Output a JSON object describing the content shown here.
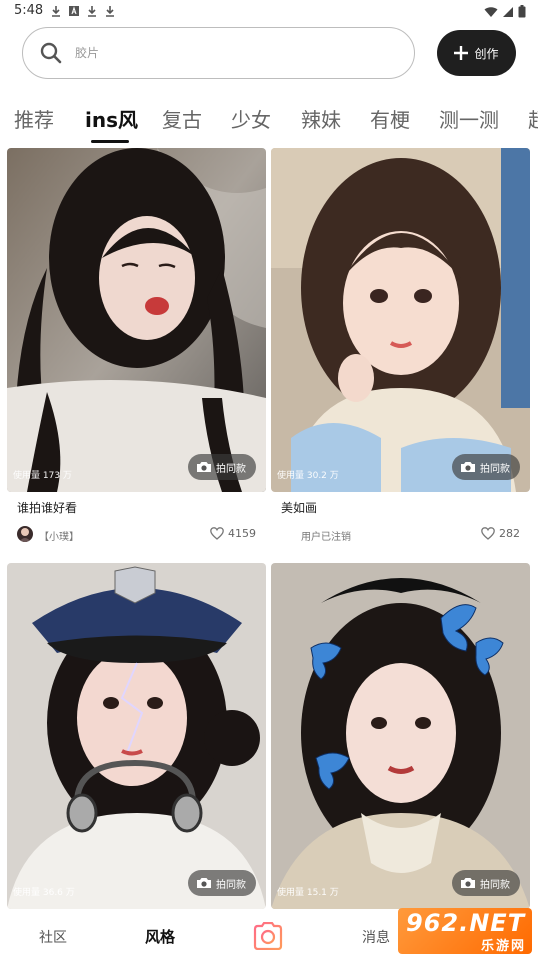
{
  "status_bar": {
    "time": "5:48"
  },
  "search": {
    "placeholder": "胶片"
  },
  "create_button": {
    "label": "创作"
  },
  "tabs": [
    {
      "label": "推荐",
      "active": false
    },
    {
      "label": "ins风",
      "active": true
    },
    {
      "label": "复古",
      "active": false
    },
    {
      "label": "少女",
      "active": false
    },
    {
      "label": "辣妹",
      "active": false
    },
    {
      "label": "有梗",
      "active": false
    },
    {
      "label": "测一测",
      "active": false
    },
    {
      "label": "超",
      "active": false
    }
  ],
  "cards": [
    {
      "usage": "使用量 173 万",
      "action": "拍同款",
      "title": "谁拍谁好看",
      "author": "【小璞】",
      "likes": "4159"
    },
    {
      "usage": "使用量 30.2 万",
      "action": "拍同款",
      "title": "美如画",
      "author": "用户已注销",
      "likes": "282"
    },
    {
      "usage": "使用量 36.6 万",
      "action": "拍同款",
      "title": "",
      "author": "",
      "likes": ""
    },
    {
      "usage": "使用量 15.1 万",
      "action": "拍同款",
      "title": "",
      "author": "",
      "likes": ""
    }
  ],
  "bottom_nav": {
    "community": "社区",
    "style": "风格",
    "messages": "消息",
    "active": "风格"
  },
  "watermark": {
    "main": "962.NET",
    "sub": "乐游网"
  },
  "colors": {
    "create_button_bg": "#1f1f1f",
    "active_tab": "#111111",
    "camera_tab_gradient": [
      "#ff6a88",
      "#ff9a5a"
    ],
    "watermark_orange": "#ff7a1a"
  },
  "icons": [
    "download-icon",
    "a-box-icon",
    "wifi-icon",
    "signal-icon",
    "battery-icon",
    "search-icon",
    "plus-icon",
    "camera-icon",
    "heart-icon",
    "camera-tab-icon"
  ]
}
